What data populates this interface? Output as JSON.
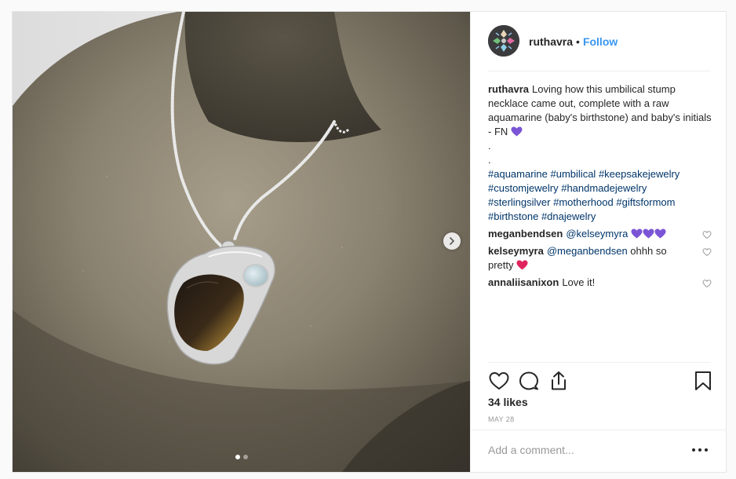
{
  "header": {
    "username": "ruthavra",
    "separator": "•",
    "follow_label": "Follow"
  },
  "caption": {
    "username": "ruthavra",
    "text": "Loving how this umbilical stump necklace came out, complete with a raw aquamarine (baby's birthstone) and baby's initials - FN",
    "dot_lines": [
      ".",
      "."
    ],
    "hashtags": [
      "#aquamarine",
      "#umbilical",
      "#keepsakejewelry",
      "#customjewelry",
      "#handmadejewelry",
      "#sterlingsilver",
      "#motherhood",
      "#giftsformom",
      "#birthstone",
      "#dnajewelry"
    ]
  },
  "comments": [
    {
      "username": "meganbendsen",
      "mention": "@kelseymyra",
      "text": ""
    },
    {
      "username": "kelseymyra",
      "mention": "@meganbendsen",
      "text": "ohhh so pretty"
    },
    {
      "username": "annaliisanixon",
      "mention": "",
      "text": "Love it!"
    }
  ],
  "likes": "34 likes",
  "date": "MAY 28",
  "add_comment_placeholder": "Add a comment...",
  "carousel": {
    "total": 2,
    "current": 1
  },
  "colors": {
    "accent": "#3897f0",
    "hashtag": "#003569",
    "purple_heart": "#7b55d6",
    "red_heart": "#e0245e"
  },
  "icons": [
    "like-icon",
    "comment-icon",
    "share-icon",
    "save-icon",
    "next-arrow-icon",
    "more-options-icon"
  ]
}
